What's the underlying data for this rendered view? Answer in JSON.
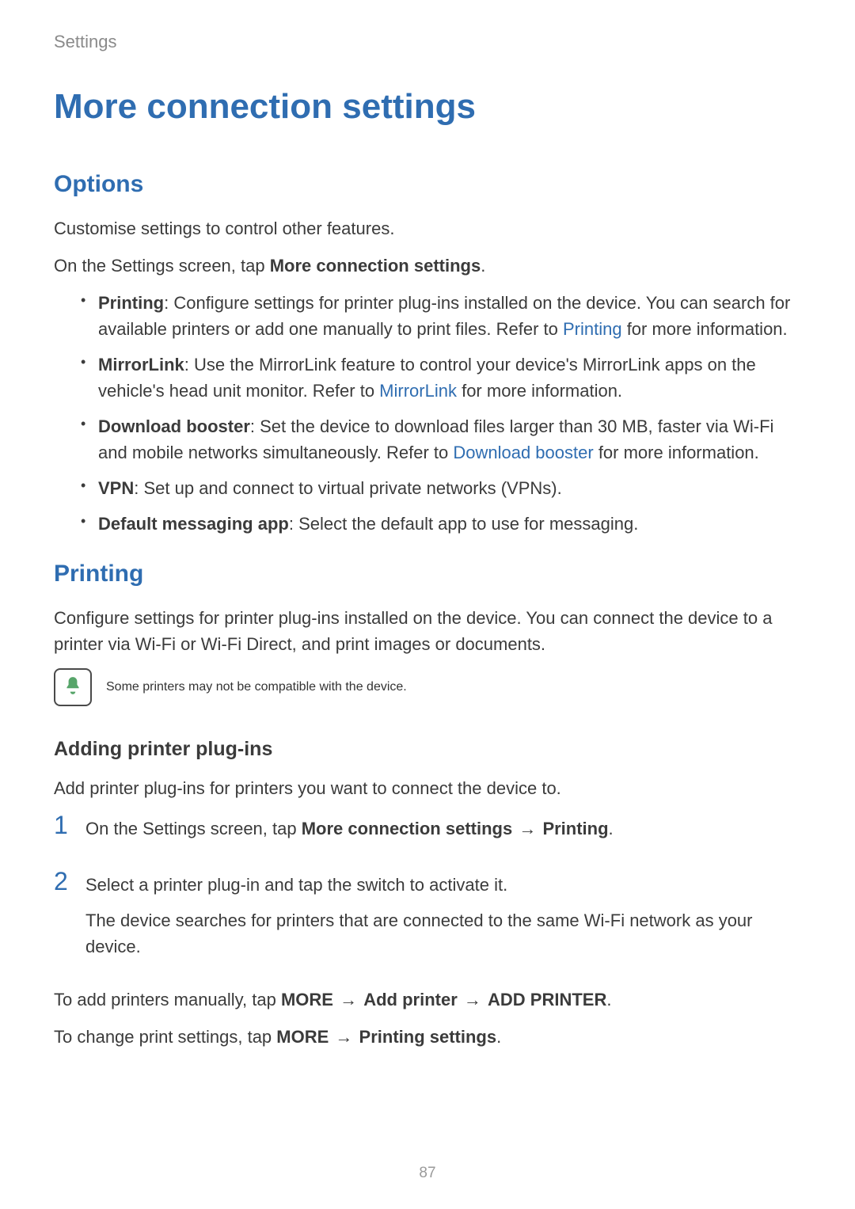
{
  "header": "Settings",
  "title": "More connection settings",
  "options": {
    "heading": "Options",
    "intro": "Customise settings to control other features.",
    "nav_pre": "On the Settings screen, tap ",
    "nav_bold": "More connection settings",
    "nav_post": "."
  },
  "items": {
    "printing": {
      "label": "Printing",
      "text_a": ": Configure settings for printer plug-ins installed on the device. You can search for available printers or add one manually to print files. Refer to ",
      "link": "Printing",
      "text_b": " for more information."
    },
    "mirrorlink": {
      "label": "MirrorLink",
      "text_a": ": Use the MirrorLink feature to control your device's MirrorLink apps on the vehicle's head unit monitor. Refer to ",
      "link": "MirrorLink",
      "text_b": " for more information."
    },
    "download": {
      "label": "Download booster",
      "text_a": ": Set the device to download files larger than 30 MB, faster via Wi-Fi and mobile networks simultaneously. Refer to ",
      "link": "Download booster",
      "text_b": " for more information."
    },
    "vpn": {
      "label": "VPN",
      "text": ": Set up and connect to virtual private networks (VPNs)."
    },
    "msg": {
      "label": "Default messaging app",
      "text": ": Select the default app to use for messaging."
    }
  },
  "printing": {
    "heading": "Printing",
    "intro": "Configure settings for printer plug-ins installed on the device. You can connect the device to a printer via Wi-Fi or Wi-Fi Direct, and print images or documents.",
    "note": "Some printers may not be compatible with the device."
  },
  "adding": {
    "heading": "Adding printer plug-ins",
    "intro": "Add printer plug-ins for printers you want to connect the device to.",
    "step1": {
      "num": "1",
      "pre": "On the Settings screen, tap ",
      "b1": "More connection settings",
      "arrow": " → ",
      "b2": "Printing",
      "post": "."
    },
    "step2": {
      "num": "2",
      "line1": "Select a printer plug-in and tap the switch to activate it.",
      "line2": "The device searches for printers that are connected to the same Wi-Fi network as your device."
    },
    "manual": {
      "pre": "To add printers manually, tap ",
      "b1": "MORE",
      "a1": " → ",
      "b2": "Add printer",
      "a2": " → ",
      "b3": "ADD PRINTER",
      "post": "."
    },
    "change": {
      "pre": "To change print settings, tap ",
      "b1": "MORE",
      "a1": " → ",
      "b2": "Printing settings",
      "post": "."
    }
  },
  "page_number": "87"
}
